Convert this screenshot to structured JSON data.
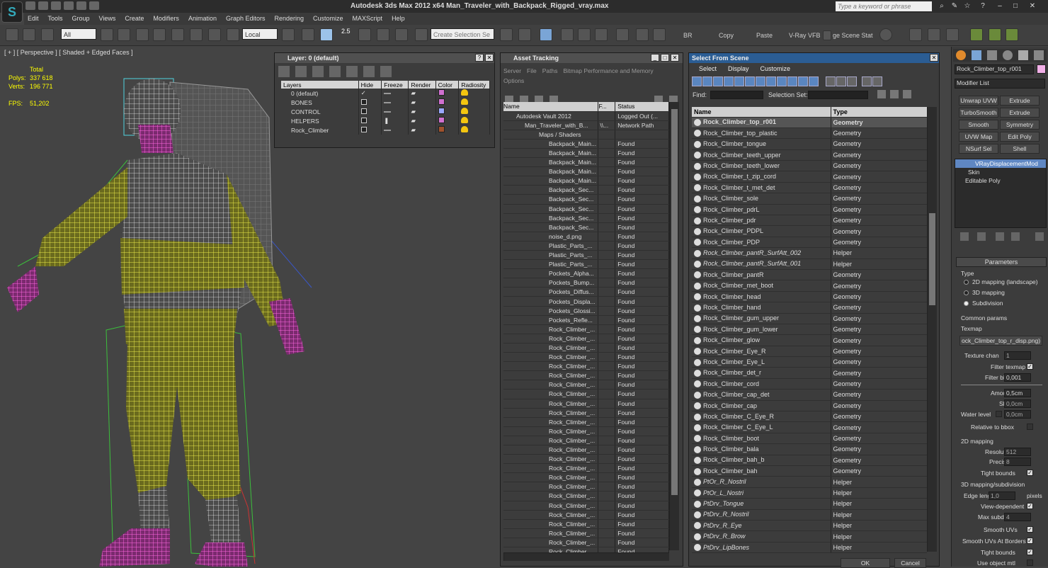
{
  "window": {
    "title": "Autodesk 3ds Max  2012 x64     Man_Traveler_with_Backpack_Rigged_vray.max",
    "search_placeholder": "Type a keyword or phrase"
  },
  "menu": [
    "Edit",
    "Tools",
    "Group",
    "Views",
    "Create",
    "Modifiers",
    "Animation",
    "Graph Editors",
    "Rendering",
    "Customize",
    "MAXScript",
    "Help"
  ],
  "toolbar": {
    "filter": "All",
    "coord": "Local",
    "snap_angle": "2.5",
    "selection_set_placeholder": "Create Selection Se",
    "br": "BR",
    "copy": "Copy",
    "paste": "Paste",
    "vfb": "V-Ray VFB",
    "scene_states": "ge Scene Stat"
  },
  "viewport": {
    "label": "[ + ] [ Perspective ] [ Shaded + Edged Faces ]",
    "stats": {
      "total": "Total",
      "polys_label": "Polys:",
      "polys": "337 618",
      "verts_label": "Verts:",
      "verts": "196 771",
      "fps_label": "FPS:",
      "fps": "51,202"
    }
  },
  "layer_dialog": {
    "title": "Layer: 0 (default)",
    "columns": [
      "Layers",
      "Hide",
      "Freeze",
      "Render",
      "Color",
      "Radiosity"
    ],
    "rows": [
      {
        "name": "0 (default)",
        "color": "#d070d0",
        "active": true
      },
      {
        "name": "BONES",
        "color": "#d070d0",
        "active": false
      },
      {
        "name": "CONTROL",
        "color": "#9aa8ff",
        "active": false
      },
      {
        "name": "HELPERS",
        "color": "#d070d0",
        "active": false
      },
      {
        "name": "Rock_Climber",
        "color": "#a0522d",
        "active": false
      }
    ]
  },
  "asset_tracking": {
    "title": "Asset Tracking",
    "menu": [
      "Server",
      "File",
      "Paths",
      "Bitmap Performance and Memory"
    ],
    "menu2": "Options",
    "columns": [
      "Name",
      "F...",
      "Status"
    ],
    "rows": [
      {
        "name": "Autodesk Vault 2012",
        "f": "",
        "status": "Logged Out (..."
      },
      {
        "name": "Man_Traveler_with_B...",
        "f": "\\\\...",
        "status": "Network Path"
      },
      {
        "name": "Maps / Shaders",
        "f": "",
        "status": ""
      },
      {
        "name": "Backpack_Main...",
        "f": "",
        "status": "Found"
      },
      {
        "name": "Backpack_Main...",
        "f": "",
        "status": "Found"
      },
      {
        "name": "Backpack_Main...",
        "f": "",
        "status": "Found"
      },
      {
        "name": "Backpack_Main...",
        "f": "",
        "status": "Found"
      },
      {
        "name": "Backpack_Main...",
        "f": "",
        "status": "Found"
      },
      {
        "name": "Backpack_Sec...",
        "f": "",
        "status": "Found"
      },
      {
        "name": "Backpack_Sec...",
        "f": "",
        "status": "Found"
      },
      {
        "name": "Backpack_Sec...",
        "f": "",
        "status": "Found"
      },
      {
        "name": "Backpack_Sec...",
        "f": "",
        "status": "Found"
      },
      {
        "name": "Backpack_Sec...",
        "f": "",
        "status": "Found"
      },
      {
        "name": "noise_d.png",
        "f": "",
        "status": "Found"
      },
      {
        "name": "Plastic_Parts_...",
        "f": "",
        "status": "Found"
      },
      {
        "name": "Plastic_Parts_...",
        "f": "",
        "status": "Found"
      },
      {
        "name": "Plastic_Parts_...",
        "f": "",
        "status": "Found"
      },
      {
        "name": "Pockets_Alpha...",
        "f": "",
        "status": "Found"
      },
      {
        "name": "Pockets_Bump...",
        "f": "",
        "status": "Found"
      },
      {
        "name": "Pockets_Diffus...",
        "f": "",
        "status": "Found"
      },
      {
        "name": "Pockets_Displa...",
        "f": "",
        "status": "Found"
      },
      {
        "name": "Pockets_Glossi...",
        "f": "",
        "status": "Found"
      },
      {
        "name": "Pockets_Refle...",
        "f": "",
        "status": "Found"
      },
      {
        "name": "Rock_Climber_...",
        "f": "",
        "status": "Found"
      },
      {
        "name": "Rock_Climber_...",
        "f": "",
        "status": "Found"
      },
      {
        "name": "Rock_Climber_...",
        "f": "",
        "status": "Found"
      },
      {
        "name": "Rock_Climber_...",
        "f": "",
        "status": "Found"
      },
      {
        "name": "Rock_Climber_...",
        "f": "",
        "status": "Found"
      },
      {
        "name": "Rock_Climber_...",
        "f": "",
        "status": "Found"
      },
      {
        "name": "Rock_Climber_...",
        "f": "",
        "status": "Found"
      },
      {
        "name": "Rock_Climber_...",
        "f": "",
        "status": "Found"
      },
      {
        "name": "Rock_Climber_...",
        "f": "",
        "status": "Found"
      },
      {
        "name": "Rock_Climber_...",
        "f": "",
        "status": "Found"
      },
      {
        "name": "Rock_Climber_...",
        "f": "",
        "status": "Found"
      },
      {
        "name": "Rock_Climber_...",
        "f": "",
        "status": "Found"
      },
      {
        "name": "Rock_Climber_...",
        "f": "",
        "status": "Found"
      },
      {
        "name": "Rock_Climber_...",
        "f": "",
        "status": "Found"
      },
      {
        "name": "Rock_Climber_...",
        "f": "",
        "status": "Found"
      },
      {
        "name": "Rock_Climber_...",
        "f": "",
        "status": "Found"
      },
      {
        "name": "Rock_Climber_...",
        "f": "",
        "status": "Found"
      },
      {
        "name": "Rock_Climber_...",
        "f": "",
        "status": "Found"
      },
      {
        "name": "Rock_Climber_...",
        "f": "",
        "status": "Found"
      },
      {
        "name": "Rock_Climber_...",
        "f": "",
        "status": "Found"
      },
      {
        "name": "Rock_Climber_...",
        "f": "",
        "status": "Found"
      },
      {
        "name": "Rock_Climber_...",
        "f": "",
        "status": "Found"
      },
      {
        "name": "Rock_Climber_...",
        "f": "",
        "status": "Found"
      },
      {
        "name": "Rock_Climber_...",
        "f": "",
        "status": "Found"
      },
      {
        "name": "Rock_Climber_...",
        "f": "",
        "status": "Found"
      }
    ]
  },
  "select_from_scene": {
    "title": "Select From Scene",
    "menu": [
      "Select",
      "Display",
      "Customize"
    ],
    "find_label": "Find:",
    "selection_set_label": "Selection Set:",
    "columns": [
      "Name",
      "Type"
    ],
    "rows": [
      {
        "name": "Rock_Climber_top_r001",
        "type": "Geometry",
        "italic": false,
        "selected": true
      },
      {
        "name": "Rock_Climber_top_plastic",
        "type": "Geometry",
        "italic": false,
        "selected": false
      },
      {
        "name": "Rock_Climber_tongue",
        "type": "Geometry",
        "italic": false,
        "selected": false
      },
      {
        "name": "Rock_Climber_teeth_upper",
        "type": "Geometry",
        "italic": false,
        "selected": false
      },
      {
        "name": "Rock_Climber_teeth_lower",
        "type": "Geometry",
        "italic": false,
        "selected": false
      },
      {
        "name": "Rock_Climber_t_zip_cord",
        "type": "Geometry",
        "italic": false,
        "selected": false
      },
      {
        "name": "Rock_Climber_t_met_det",
        "type": "Geometry",
        "italic": false,
        "selected": false
      },
      {
        "name": "Rock_Climber_sole",
        "type": "Geometry",
        "italic": false,
        "selected": false
      },
      {
        "name": "Rock_Climber_pdrL",
        "type": "Geometry",
        "italic": false,
        "selected": false
      },
      {
        "name": "Rock_Climber_pdr",
        "type": "Geometry",
        "italic": false,
        "selected": false
      },
      {
        "name": "Rock_Climber_PDPL",
        "type": "Geometry",
        "italic": false,
        "selected": false
      },
      {
        "name": "Rock_Climber_PDP",
        "type": "Geometry",
        "italic": false,
        "selected": false
      },
      {
        "name": "Rock_Climber_pantR_SurfAtt_002",
        "type": "Helper",
        "italic": true,
        "selected": false
      },
      {
        "name": "Rock_Climber_pantR_SurfAtt_001",
        "type": "Helper",
        "italic": true,
        "selected": false
      },
      {
        "name": "Rock_Climber_pantR",
        "type": "Geometry",
        "italic": false,
        "selected": false
      },
      {
        "name": "Rock_Climber_met_boot",
        "type": "Geometry",
        "italic": false,
        "selected": false
      },
      {
        "name": "Rock_Climber_head",
        "type": "Geometry",
        "italic": false,
        "selected": false
      },
      {
        "name": "Rock_Climber_hand",
        "type": "Geometry",
        "italic": false,
        "selected": false
      },
      {
        "name": "Rock_Climber_gum_upper",
        "type": "Geometry",
        "italic": false,
        "selected": false
      },
      {
        "name": "Rock_Climber_gum_lower",
        "type": "Geometry",
        "italic": false,
        "selected": false
      },
      {
        "name": "Rock_Climber_glow",
        "type": "Geometry",
        "italic": false,
        "selected": false
      },
      {
        "name": "Rock_Climber_Eye_R",
        "type": "Geometry",
        "italic": false,
        "selected": false
      },
      {
        "name": "Rock_Climber_Eye_L",
        "type": "Geometry",
        "italic": false,
        "selected": false
      },
      {
        "name": "Rock_Climber_det_r",
        "type": "Geometry",
        "italic": false,
        "selected": false
      },
      {
        "name": "Rock_Climber_cord",
        "type": "Geometry",
        "italic": false,
        "selected": false
      },
      {
        "name": "Rock_Climber_cap_det",
        "type": "Geometry",
        "italic": false,
        "selected": false
      },
      {
        "name": "Rock_Climber_cap",
        "type": "Geometry",
        "italic": false,
        "selected": false
      },
      {
        "name": "Rock_Climber_C_Eye_R",
        "type": "Geometry",
        "italic": false,
        "selected": false
      },
      {
        "name": "Rock_Climber_C_Eye_L",
        "type": "Geometry",
        "italic": false,
        "selected": false
      },
      {
        "name": "Rock_Climber_boot",
        "type": "Geometry",
        "italic": false,
        "selected": false
      },
      {
        "name": "Rock_Climber_bala",
        "type": "Geometry",
        "italic": false,
        "selected": false
      },
      {
        "name": "Rock_Climber_bah_b",
        "type": "Geometry",
        "italic": false,
        "selected": false
      },
      {
        "name": "Rock_Climber_bah",
        "type": "Geometry",
        "italic": false,
        "selected": false
      },
      {
        "name": "PtOr_R_Nostril",
        "type": "Helper",
        "italic": true,
        "selected": false
      },
      {
        "name": "PtOr_L_Nostri",
        "type": "Helper",
        "italic": true,
        "selected": false
      },
      {
        "name": "PtDrv_Tongue",
        "type": "Helper",
        "italic": true,
        "selected": false
      },
      {
        "name": "PtDrv_R_Nostril",
        "type": "Helper",
        "italic": true,
        "selected": false
      },
      {
        "name": "PtDrv_R_Eye",
        "type": "Helper",
        "italic": true,
        "selected": false
      },
      {
        "name": "PtDrv_R_Brow",
        "type": "Helper",
        "italic": true,
        "selected": false
      },
      {
        "name": "PtDrv_LipBones",
        "type": "Helper",
        "italic": true,
        "selected": false
      }
    ],
    "ok": "OK",
    "cancel": "Cancel"
  },
  "command_panel": {
    "object_name": "Rock_Climber_top_r001",
    "modifier_list": "Modifier List",
    "buttons": [
      "Unwrap UVW",
      "Extrude",
      "TurboSmooth",
      "Extrude",
      "Smooth",
      "Symmetry",
      "UVW Map",
      "Edit Poly",
      "NSurf Sel",
      "Shell"
    ],
    "stack": [
      "VRayDisplacementMod",
      "Skin",
      "Editable Poly"
    ],
    "params": {
      "rollout": "Parameters",
      "type": "Type",
      "r1": "2D mapping (landscape)",
      "r2": "3D mapping",
      "r3": "Subdivision",
      "common": "Common params",
      "texmap": "Texmap",
      "texmap_val": "ock_Climber_top_r_disp.png)",
      "tex_chan": "Texture chan",
      "tex_chan_val": "1",
      "filter_texmap": "Filter texmap",
      "filter_blur": "Filter blur",
      "filter_blur_val": "0,001",
      "amount": "Amount",
      "amount_val": "0,5cm",
      "shift": "Shift",
      "shift_val": "0,0cm",
      "water": "Water level",
      "water_val": "0,0cm",
      "relative": "Relative to bbox",
      "map2d": "2D mapping",
      "resolution": "Resolution",
      "resolution_val": "512",
      "precision": "Precision",
      "precision_val": "8",
      "tight": "Tight bounds",
      "map3d": "3D mapping/subdivision",
      "edge": "Edge length",
      "edge_val": "1,0",
      "pixels": "pixels",
      "view_dep": "View-dependent",
      "max_sub": "Max subdivs",
      "max_sub_val": "4",
      "smooth_uvs": "Smooth UVs",
      "smooth_border": "Smooth UVs At Borders",
      "tight2": "Tight bounds",
      "use_obj": "Use object mtl"
    }
  }
}
